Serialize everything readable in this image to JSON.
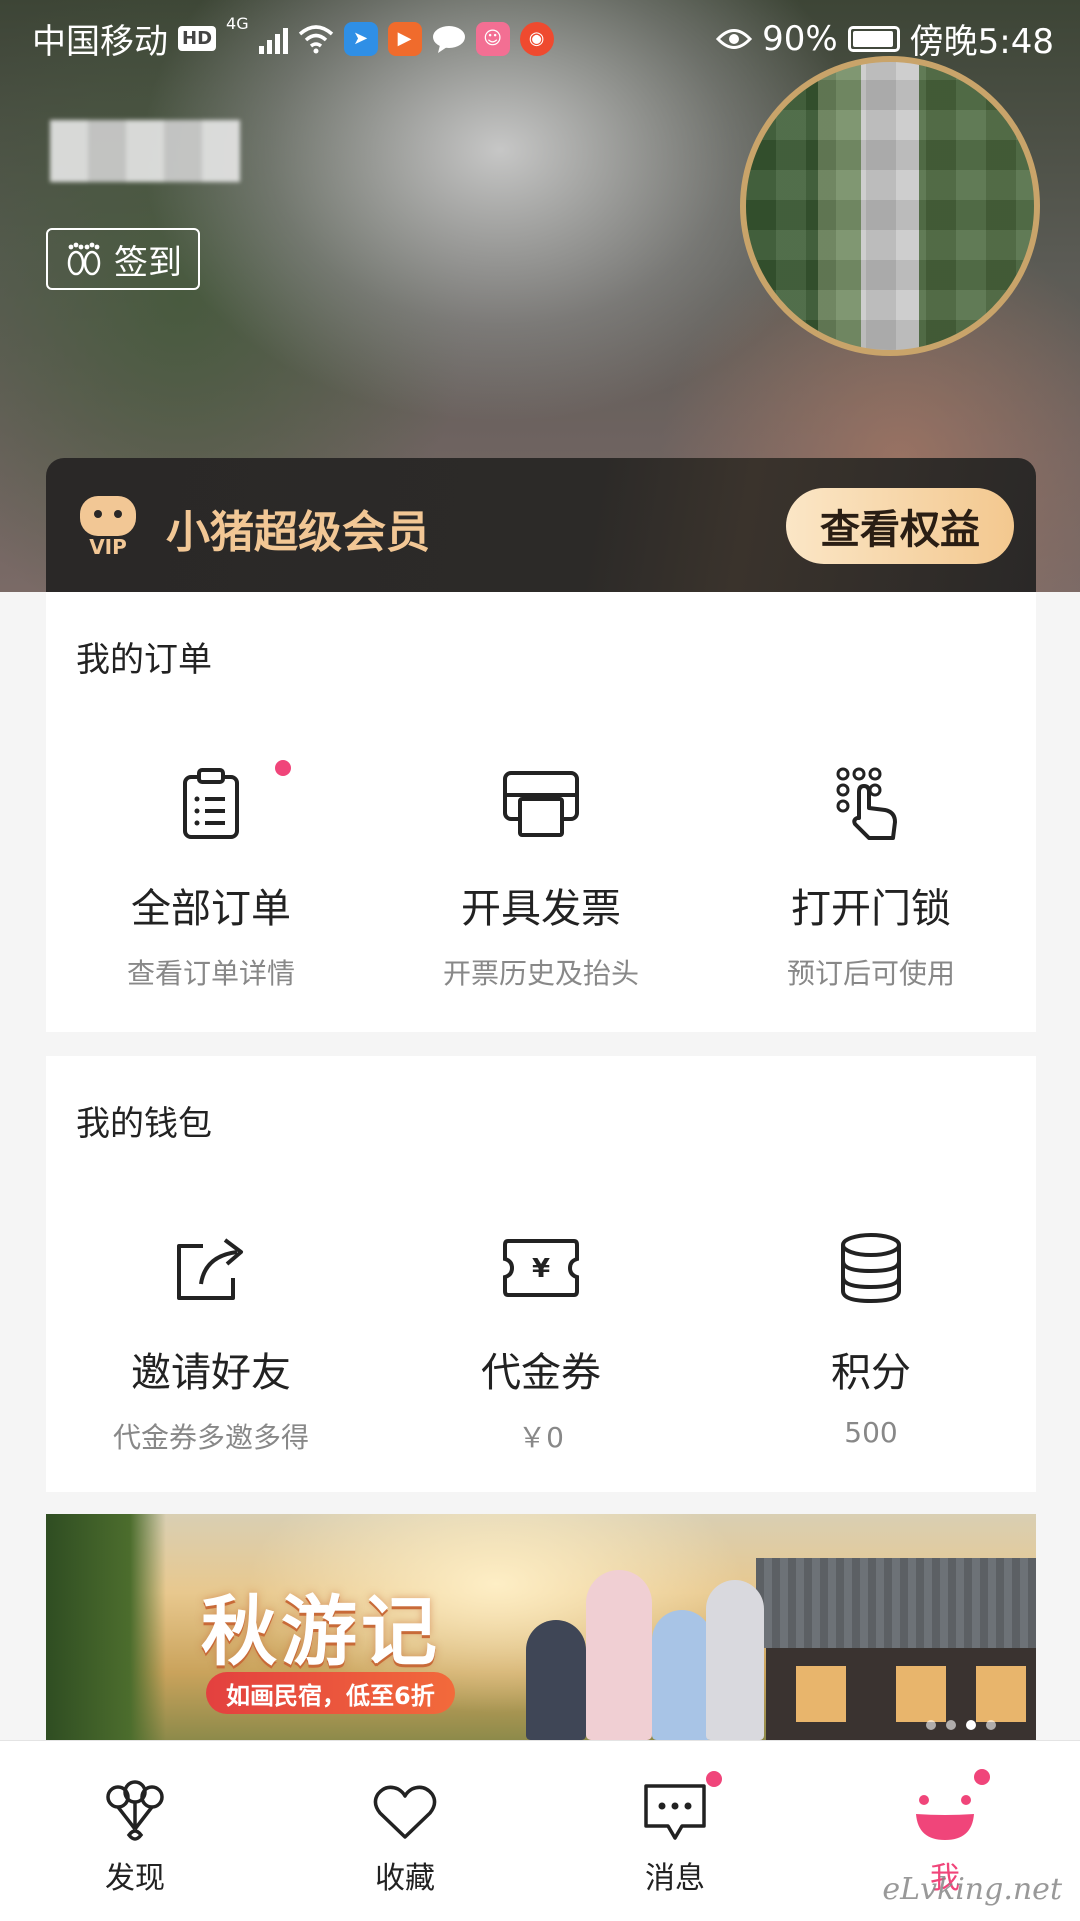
{
  "status_bar": {
    "carrier": "中国移动",
    "hd": "HD",
    "network": "4G",
    "battery": "90%",
    "time": "傍晚5:48"
  },
  "profile": {
    "signin_label": "签到"
  },
  "vip": {
    "logo_text": "VIP",
    "title": "小猪超级会员",
    "button_label": "查看权益"
  },
  "orders": {
    "title": "我的订单",
    "items": [
      {
        "label": "全部订单",
        "sub": "查看订单详情",
        "icon": "clipboard-list-icon"
      },
      {
        "label": "开具发票",
        "sub": "开票历史及抬头",
        "icon": "invoice-printer-icon"
      },
      {
        "label": "打开门锁",
        "sub": "预订后可使用",
        "icon": "keypad-touch-icon"
      }
    ]
  },
  "wallet": {
    "title": "我的钱包",
    "items": [
      {
        "label": "邀请好友",
        "sub": "代金券多邀多得",
        "icon": "share-arrow-icon"
      },
      {
        "label": "代金券",
        "sub": "￥0",
        "icon": "voucher-ticket-icon"
      },
      {
        "label": "积分",
        "sub": "500",
        "icon": "coins-stack-icon"
      }
    ]
  },
  "banner": {
    "title": "秋游记",
    "tag": "如画民宿，低至6折"
  },
  "tabbar": {
    "items": [
      {
        "label": "发现",
        "icon": "balloons-icon"
      },
      {
        "label": "收藏",
        "icon": "heart-icon"
      },
      {
        "label": "消息",
        "icon": "chat-bubble-icon"
      },
      {
        "label": "我",
        "icon": "smiley-pig-icon"
      }
    ]
  },
  "watermark": "eLvking.net",
  "colors": {
    "accent": "#f0457a",
    "vip_gold": "#f2c795",
    "vip_dark": "#2a2827"
  }
}
